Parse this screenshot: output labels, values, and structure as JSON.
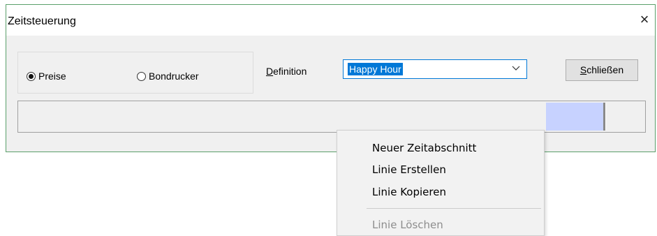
{
  "window": {
    "title": "Zeitsteuerung",
    "close_glyph": "×"
  },
  "mode": {
    "options": [
      {
        "label": "Preise",
        "selected": true
      },
      {
        "label": "Bondrucker",
        "selected": false
      }
    ]
  },
  "definition": {
    "label_mnemonic": "D",
    "label_rest": "efinition",
    "value": "Happy Hour"
  },
  "buttons": {
    "close_mnemonic": "S",
    "close_rest": "chließen"
  },
  "context_menu": {
    "items": [
      {
        "label": "Neuer Zeitabschnitt",
        "enabled": true
      },
      {
        "label": "Linie Erstellen",
        "enabled": true
      },
      {
        "label": "Linie Kopieren",
        "enabled": true
      },
      {
        "label": "Linie Löschen",
        "enabled": false
      }
    ]
  },
  "colors": {
    "window_border": "#5a9f6a",
    "selection": "#0078d7",
    "timeline_segment": "#c7d2ff"
  }
}
